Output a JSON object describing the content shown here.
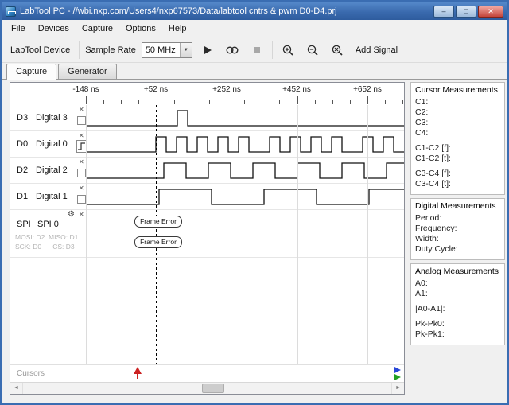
{
  "window": {
    "title": "LabTool PC - //wbi.nxp.com/Users4/nxp67573/Data/labtool cntrs & pwm D0-D4.prj",
    "controls": {
      "minimize": "–",
      "maximize": "□",
      "close": "✕"
    }
  },
  "menu": {
    "items": [
      "File",
      "Devices",
      "Capture",
      "Options",
      "Help"
    ]
  },
  "toolbar": {
    "device_button": "LabTool Device",
    "sample_rate_label": "Sample Rate",
    "sample_rate_value": "50 MHz",
    "add_signal_button": "Add Signal"
  },
  "icons": {
    "play": "▶",
    "continuous": "∞",
    "stop": "■",
    "gear": "⚙",
    "close_signal": "✕",
    "dropdown_arrow": "▼",
    "scroll_left": "◄",
    "scroll_right": "►"
  },
  "tabs": {
    "capture": "Capture",
    "generator": "Generator"
  },
  "axis": {
    "labels": [
      "-148 ns",
      "+52 ns",
      "+252 ns",
      "+452 ns",
      "+652 ns"
    ]
  },
  "signals": [
    {
      "id": "D3",
      "name": "Digital 3"
    },
    {
      "id": "D0",
      "name": "Digital 0"
    },
    {
      "id": "D2",
      "name": "Digital 2"
    },
    {
      "id": "D1",
      "name": "Digital 1"
    },
    {
      "id": "SPI",
      "name": "SPI 0",
      "detail1": "MOSI: D2  MISO: D1",
      "detail2": "SCK: D0      CS: D3",
      "frame_errors": [
        "Frame Error",
        "Frame Error"
      ]
    }
  ],
  "waveforms": {
    "D3": {
      "initial": 0,
      "transitions": [
        115,
        128
      ]
    },
    "D0": {
      "initial": 0,
      "transitions": [
        88,
        101,
        114,
        127,
        140,
        153,
        166,
        179,
        192,
        205,
        231,
        244,
        257,
        270,
        283,
        296,
        309,
        322,
        348,
        361,
        374,
        387
      ]
    },
    "D2": {
      "initial": 0,
      "transitions": [
        98,
        126,
        154,
        182,
        210,
        238,
        266,
        294,
        322,
        350,
        378
      ]
    },
    "D1": {
      "initial": 0,
      "transitions": [
        92,
        158,
        224,
        290,
        356
      ]
    }
  },
  "cursor_row": {
    "label": "Cursors"
  },
  "measurements": {
    "cursor": {
      "title": "Cursor Measurements",
      "items": [
        "C1:",
        "C2:",
        "C3:",
        "C4:",
        "",
        "C1-C2 [f]:",
        "C1-C2 [t]:",
        "",
        "C3-C4 [f]:",
        "C3-C4 [t]:"
      ]
    },
    "digital": {
      "title": "Digital Measurements",
      "items": [
        "Period:",
        "Frequency:",
        "Width:",
        "Duty Cycle:"
      ]
    },
    "analog": {
      "title": "Analog Measurements",
      "items": [
        "A0:",
        "A1:",
        "",
        "|A0-A1|:",
        "",
        "Pk-Pk0:",
        "Pk-Pk1:"
      ]
    }
  },
  "colors": {
    "cursor_red": "#cc2222",
    "trigger_line": "#000000",
    "grid": "#dcdcdc",
    "cursor_blue": "#2947d8",
    "cursor_green": "#22a022"
  }
}
